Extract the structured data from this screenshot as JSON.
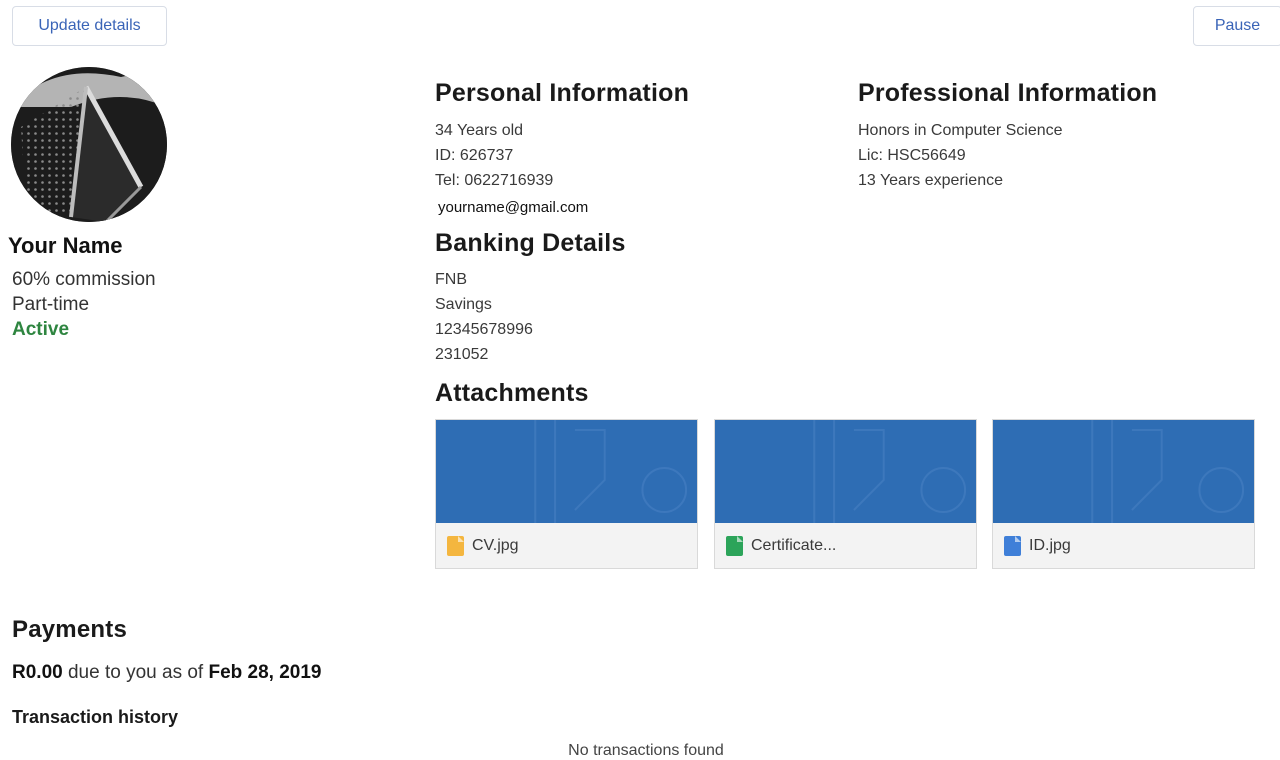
{
  "toolbar": {
    "update_label": "Update details",
    "pause_label": "Pause"
  },
  "profile": {
    "name": "Your Name",
    "commission": "60% commission",
    "employment": "Part-time",
    "status": "Active",
    "status_color": "#2e8540"
  },
  "personal": {
    "title": "Personal Information",
    "age": "34 Years old",
    "id": "ID: 626737",
    "tel": "Tel: 0622716939",
    "email": "yourname@gmail.com"
  },
  "professional": {
    "title": "Professional Information",
    "qualification": "Honors in Computer Science",
    "license": "Lic: HSC56649",
    "experience": "13 Years experience"
  },
  "banking": {
    "title": "Banking Details",
    "bank": "FNB",
    "account_type": "Savings",
    "account_number": "12345678996",
    "branch_code": "231052"
  },
  "attachments": {
    "title": "Attachments",
    "thumb_color": "#2e6db4",
    "items": [
      {
        "name": "CV.jpg",
        "icon": "document-icon",
        "icon_color": "#f4b63f"
      },
      {
        "name": "Certificate...",
        "icon": "spreadsheet-icon",
        "icon_color": "#2ca45a"
      },
      {
        "name": "ID.jpg",
        "icon": "image-file-icon",
        "icon_color": "#3f7fd8"
      }
    ]
  },
  "payments": {
    "title": "Payments",
    "amount": "R0.00",
    "due_text": " due to you as of ",
    "date": "Feb 28, 2019",
    "history_title": "Transaction history",
    "empty_text": "No transactions found"
  },
  "colors": {
    "button_text": "#3a64b7",
    "accent_blue": "#2e6db4"
  }
}
